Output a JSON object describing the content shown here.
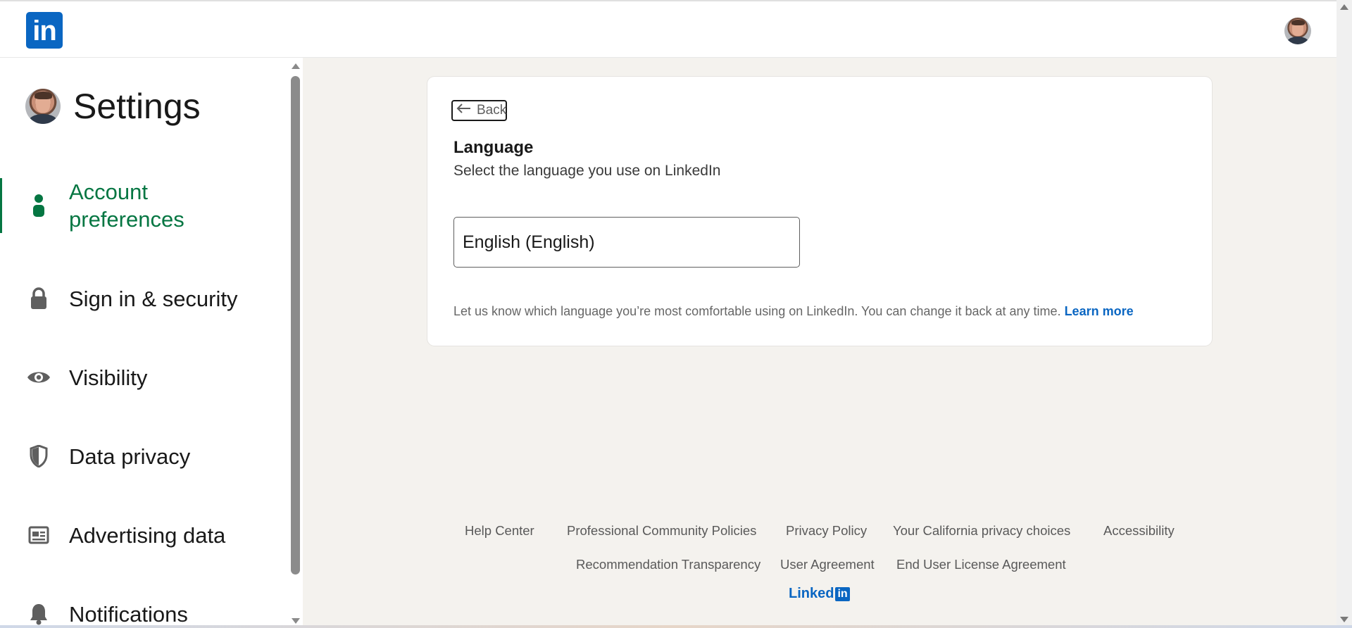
{
  "header": {
    "logo_text": "in",
    "brand_color": "#0a66c2"
  },
  "sidebar": {
    "title": "Settings",
    "items": [
      {
        "label": "Account preferences",
        "icon": "person-icon",
        "active": true
      },
      {
        "label": "Sign in & security",
        "icon": "lock-icon",
        "active": false
      },
      {
        "label": "Visibility",
        "icon": "eye-icon",
        "active": false
      },
      {
        "label": "Data privacy",
        "icon": "shield-icon",
        "active": false
      },
      {
        "label": "Advertising data",
        "icon": "newspaper-icon",
        "active": false
      },
      {
        "label": "Notifications",
        "icon": "bell-icon",
        "active": false
      }
    ],
    "active_color": "#057642"
  },
  "main": {
    "back_label": "Back",
    "title": "Language",
    "subtitle": "Select the language you use on LinkedIn",
    "language_select": {
      "value": "English (English)"
    },
    "helper_text": "Let us know which language you’re most comfortable using on LinkedIn. You can change it back at any time.",
    "learn_more": "Learn more"
  },
  "footer": {
    "row1": [
      "Help Center",
      "Professional Community Policies",
      "Privacy Policy",
      "Your California privacy choices",
      "Accessibility"
    ],
    "row2": [
      "Recommendation Transparency",
      "User Agreement",
      "End User License Agreement"
    ],
    "brand_word": "Linked",
    "brand_box": "in"
  }
}
